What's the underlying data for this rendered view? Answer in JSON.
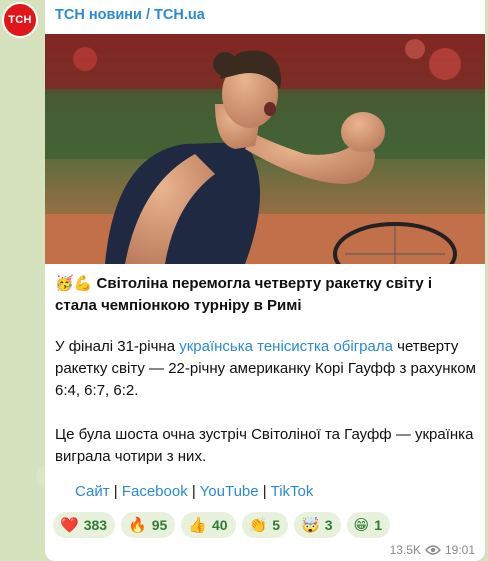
{
  "channel": {
    "avatar_text": "ТСН",
    "name": "ТСН новини / TCH.ua"
  },
  "post": {
    "headline_emoji": "🥳💪",
    "headline": "Світоліна перемогла четверту ракетку світу і стала чемпіонкою турніру в Римі",
    "para1_before": "У фіналі 31-річна ",
    "para1_link": "українська тенісистка обіграла",
    "para1_after": " четверту ракетку світу — 22-річну американку Корі Гауфф з рахунком 6:4, 6:7, 6:2.",
    "para2": "Це була шоста очна зустріч Світоліної та Гауфф — українка виграла чотири з них.",
    "links": [
      "Сайт",
      "Facebook",
      "YouTube",
      "TikTok"
    ],
    "separator": " | "
  },
  "reactions": [
    {
      "emoji": "❤️",
      "icon": "heart-icon",
      "count": "383"
    },
    {
      "emoji": "🔥",
      "icon": "fire-icon",
      "count": "95"
    },
    {
      "emoji": "👍",
      "icon": "thumbs-up-icon",
      "count": "40"
    },
    {
      "emoji": "👏",
      "icon": "clapping-icon",
      "count": "5"
    },
    {
      "emoji": "🤯",
      "icon": "mind-blown-icon",
      "count": "3"
    },
    {
      "emoji": "😁",
      "icon": "grin-icon",
      "count": "1"
    }
  ],
  "meta": {
    "views": "13.5K",
    "time": "19:01"
  },
  "colors": {
    "accent": "#2a8bd0",
    "avatar_bg": "#e0161b",
    "reaction_bg": "#e8f1dc",
    "reaction_text": "#2f7d32"
  }
}
